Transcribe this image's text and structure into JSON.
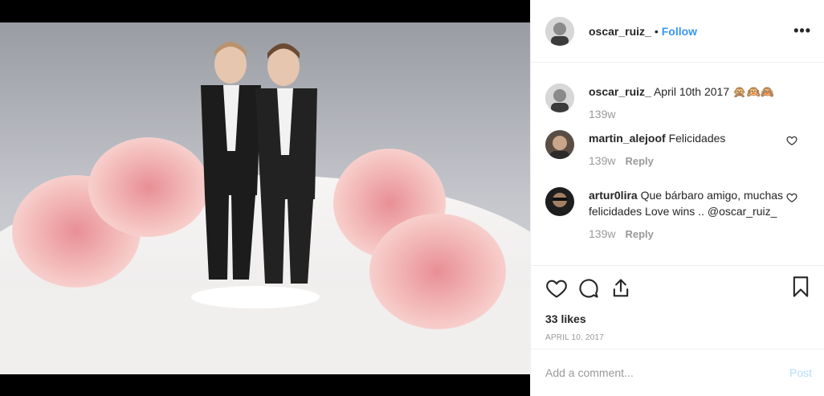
{
  "post": {
    "author": "oscar_ruiz_",
    "separator": "•",
    "follow_label": "Follow",
    "more_label": "•••"
  },
  "comments": [
    {
      "user": "oscar_ruiz_",
      "text": "April 10th 2017 🙊🙉🙈",
      "time": "139w",
      "reply": ""
    },
    {
      "user": "martin_alejoof",
      "text": "Felicidades",
      "time": "139w",
      "reply": "Reply"
    },
    {
      "user": "artur0lira",
      "text": "Que bárbaro amigo, muchas felicidades Love wins .. @oscar_ruiz_",
      "time": "139w",
      "reply": "Reply"
    }
  ],
  "actions": {
    "like_icon": "heart-icon",
    "comment_icon": "comment-icon",
    "share_icon": "share-icon",
    "save_icon": "bookmark-icon",
    "likes_text": "33 likes",
    "date_text": "April 10, 2017"
  },
  "compose": {
    "placeholder": "Add a comment...",
    "post_label": "Post"
  },
  "colors": {
    "accent": "#3897f0",
    "post_disabled": "#b2dffc",
    "muted": "#999999"
  }
}
